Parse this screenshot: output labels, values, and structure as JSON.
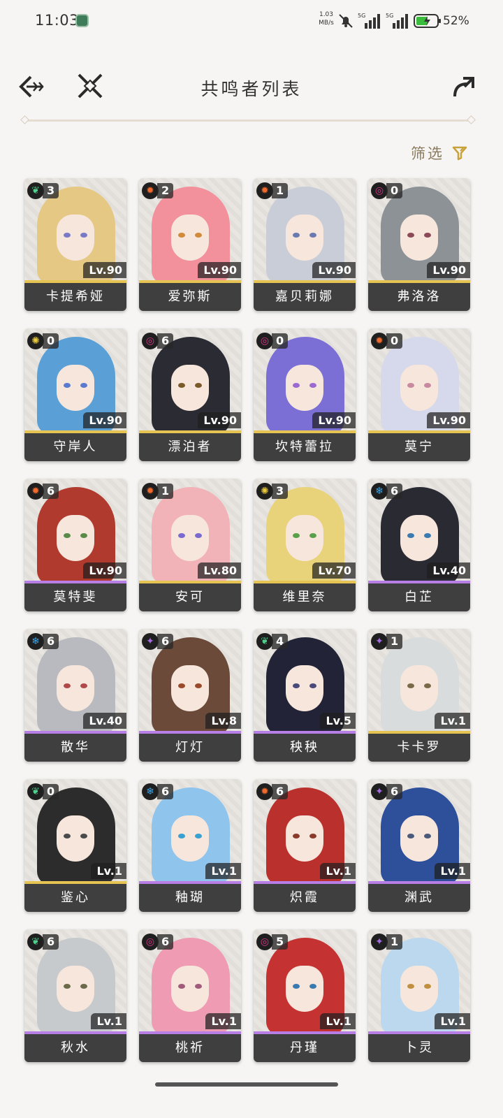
{
  "status_bar": {
    "time": "11:03",
    "speed_line1": "1.03",
    "speed_line2": "MB/s",
    "network1": "5G",
    "network2": "5G",
    "battery": "52"
  },
  "header": {
    "title": "共鸣者列表"
  },
  "filter": {
    "label": "筛选"
  },
  "colors": {
    "rarity5": "#e6c454",
    "rarity4": "#b77fe6",
    "name_bg": "#3f3f3f"
  },
  "characters": [
    {
      "name": "卡提希娅",
      "level": "Lv.90",
      "sequence": "3",
      "element": "aero",
      "rarity": 5
    },
    {
      "name": "爱弥斯",
      "level": "Lv.90",
      "sequence": "2",
      "element": "fusion",
      "rarity": 5
    },
    {
      "name": "嘉贝莉娜",
      "level": "Lv.90",
      "sequence": "1",
      "element": "fusion",
      "rarity": 5
    },
    {
      "name": "弗洛洛",
      "level": "Lv.90",
      "sequence": "0",
      "element": "havoc",
      "rarity": 5
    },
    {
      "name": "守岸人",
      "level": "Lv.90",
      "sequence": "0",
      "element": "spectro",
      "rarity": 5
    },
    {
      "name": "漂泊者",
      "level": "Lv.90",
      "sequence": "6",
      "element": "havoc",
      "rarity": 5
    },
    {
      "name": "坎特蕾拉",
      "level": "Lv.90",
      "sequence": "0",
      "element": "havoc",
      "rarity": 5
    },
    {
      "name": "莫宁",
      "level": "Lv.90",
      "sequence": "0",
      "element": "fusion",
      "rarity": 5
    },
    {
      "name": "莫特斐",
      "level": "Lv.90",
      "sequence": "6",
      "element": "fusion",
      "rarity": 4
    },
    {
      "name": "安可",
      "level": "Lv.80",
      "sequence": "1",
      "element": "fusion",
      "rarity": 5
    },
    {
      "name": "维里奈",
      "level": "Lv.70",
      "sequence": "3",
      "element": "spectro",
      "rarity": 5
    },
    {
      "name": "白芷",
      "level": "Lv.40",
      "sequence": "6",
      "element": "glacio",
      "rarity": 4
    },
    {
      "name": "散华",
      "level": "Lv.40",
      "sequence": "6",
      "element": "glacio",
      "rarity": 4
    },
    {
      "name": "灯灯",
      "level": "Lv.8",
      "sequence": "6",
      "element": "electro",
      "rarity": 4
    },
    {
      "name": "秧秧",
      "level": "Lv.5",
      "sequence": "4",
      "element": "aero",
      "rarity": 4
    },
    {
      "name": "卡卡罗",
      "level": "Lv.1",
      "sequence": "1",
      "element": "electro",
      "rarity": 5
    },
    {
      "name": "鉴心",
      "level": "Lv.1",
      "sequence": "0",
      "element": "aero",
      "rarity": 5
    },
    {
      "name": "釉瑚",
      "level": "Lv.1",
      "sequence": "6",
      "element": "glacio",
      "rarity": 4
    },
    {
      "name": "炽霞",
      "level": "Lv.1",
      "sequence": "6",
      "element": "fusion",
      "rarity": 4
    },
    {
      "name": "渊武",
      "level": "Lv.1",
      "sequence": "6",
      "element": "electro",
      "rarity": 4
    },
    {
      "name": "秋水",
      "level": "Lv.1",
      "sequence": "6",
      "element": "aero",
      "rarity": 4
    },
    {
      "name": "桃祈",
      "level": "Lv.1",
      "sequence": "6",
      "element": "havoc",
      "rarity": 4
    },
    {
      "name": "丹瑾",
      "level": "Lv.1",
      "sequence": "5",
      "element": "havoc",
      "rarity": 4
    },
    {
      "name": "卜灵",
      "level": "Lv.1",
      "sequence": "1",
      "element": "electro",
      "rarity": 4
    }
  ]
}
